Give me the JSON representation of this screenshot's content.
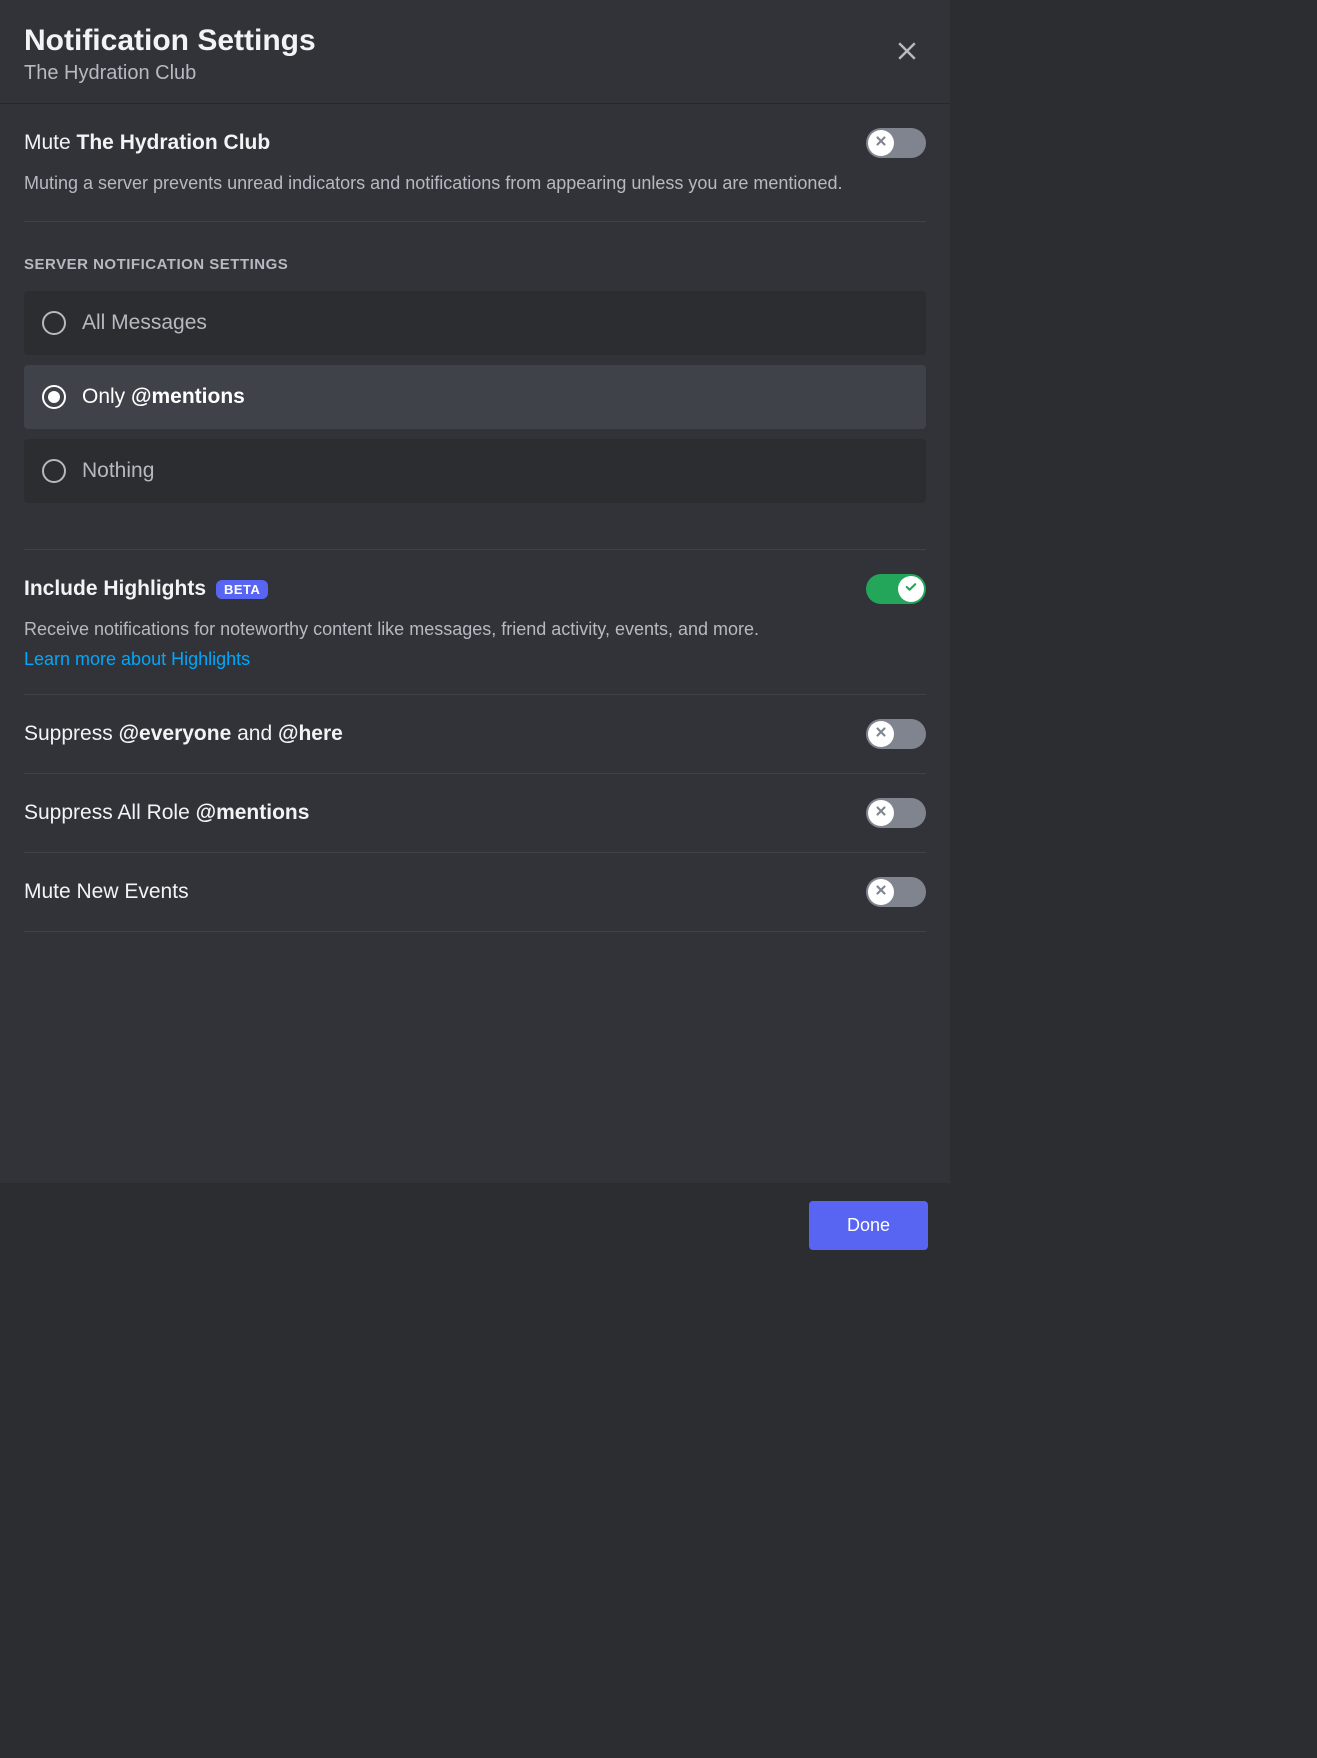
{
  "header": {
    "title": "Notification Settings",
    "subtitle": "The Hydration Club"
  },
  "mute": {
    "label_prefix": "Mute ",
    "label_bold": "The Hydration Club",
    "description": "Muting a server prevents unread indicators and notifications from appearing unless you are mentioned.",
    "enabled": false
  },
  "server_settings": {
    "heading": "SERVER NOTIFICATION SETTINGS",
    "options": [
      {
        "label_pre": "All Messages",
        "label_bold": "",
        "selected": false
      },
      {
        "label_pre": "Only ",
        "label_bold": "@mentions",
        "selected": true
      },
      {
        "label_pre": "Nothing",
        "label_bold": "",
        "selected": false
      }
    ]
  },
  "highlights": {
    "title": "Include Highlights",
    "badge": "BETA",
    "description": "Receive notifications for noteworthy content like messages, friend activity, events, and more.",
    "link": "Learn more about Highlights",
    "enabled": true
  },
  "suppress_everyone": {
    "label_pre": "Suppress ",
    "label_bold1": "@everyone",
    "label_mid": " and ",
    "label_bold2": "@here",
    "enabled": false
  },
  "suppress_roles": {
    "label_pre": "Suppress All Role ",
    "label_bold": "@mentions",
    "enabled": false
  },
  "mute_events": {
    "label": "Mute New Events",
    "enabled": false
  },
  "footer": {
    "done": "Done"
  }
}
